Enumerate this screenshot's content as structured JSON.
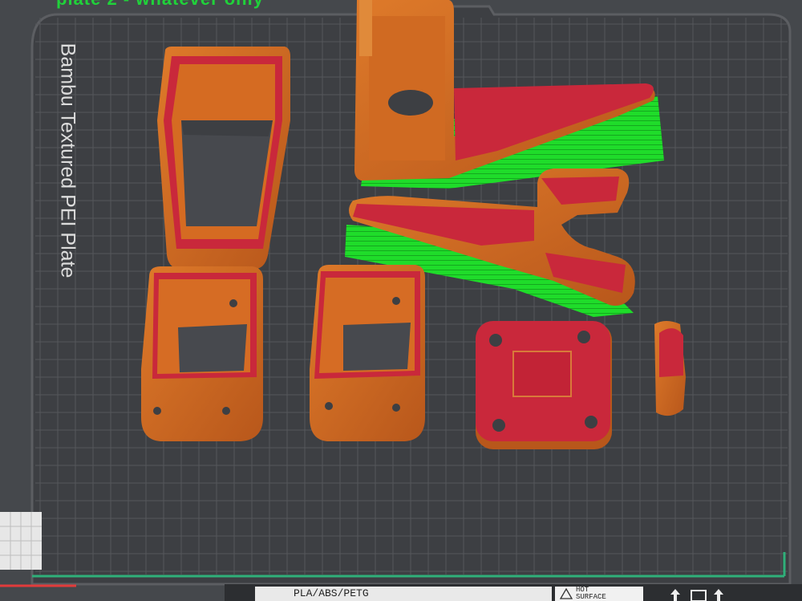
{
  "scene": {
    "top_label": "plate 2 - whatever only",
    "plate_name": "Bambu Textured PEI Plate"
  },
  "colors": {
    "plate_bg": "#3d3f43",
    "plate_border": "#5a5c60",
    "grid": "#55575b",
    "orange": "#d1681f",
    "orange_dark": "#a9501a",
    "red": "#c9283b",
    "support_green": "#1fdc2a",
    "axis_green": "#2fb07a",
    "axis_red": "#e23b3b"
  },
  "footer": {
    "filament": "PLA/ABS/PETG",
    "hotbed_line1": "HOT",
    "hotbed_line2": "SURFACE",
    "hotbed_icon": "warning-triangle-icon",
    "nav_icons": [
      "arrow-up-icon",
      "home-icon",
      "arrow-up-icon"
    ]
  }
}
